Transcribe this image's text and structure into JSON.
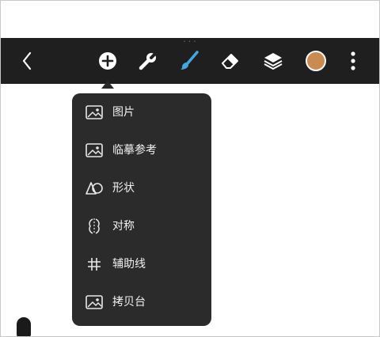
{
  "toolbar": {
    "grabber_dots": "• • •",
    "buttons": [
      {
        "id": "back",
        "icon": "chevron-left-icon"
      },
      {
        "id": "add",
        "icon": "plus-circle-icon"
      },
      {
        "id": "settings",
        "icon": "wrench-icon"
      },
      {
        "id": "brush",
        "icon": "brush-icon",
        "active_color": "#3fa9e0"
      },
      {
        "id": "eraser",
        "icon": "eraser-icon"
      },
      {
        "id": "layers",
        "icon": "layers-icon"
      },
      {
        "id": "color",
        "icon": "color-swatch",
        "swatch_color": "#c98b4f"
      },
      {
        "id": "more",
        "icon": "more-vertical-icon"
      }
    ]
  },
  "add_menu": {
    "items": [
      {
        "label": "图片",
        "icon": "image-icon"
      },
      {
        "label": "临摹参考",
        "icon": "image-icon"
      },
      {
        "label": "形状",
        "icon": "shapes-icon"
      },
      {
        "label": "对称",
        "icon": "symmetry-icon"
      },
      {
        "label": "辅助线",
        "icon": "grid-hash-icon"
      },
      {
        "label": "拷贝台",
        "icon": "image-icon"
      }
    ]
  },
  "colors": {
    "toolbar_bg": "#1f1f1f",
    "menu_bg": "#2b2b2b",
    "icon_white": "#ffffff",
    "accent_blue": "#3fa9e0",
    "swatch": "#c98b4f"
  }
}
